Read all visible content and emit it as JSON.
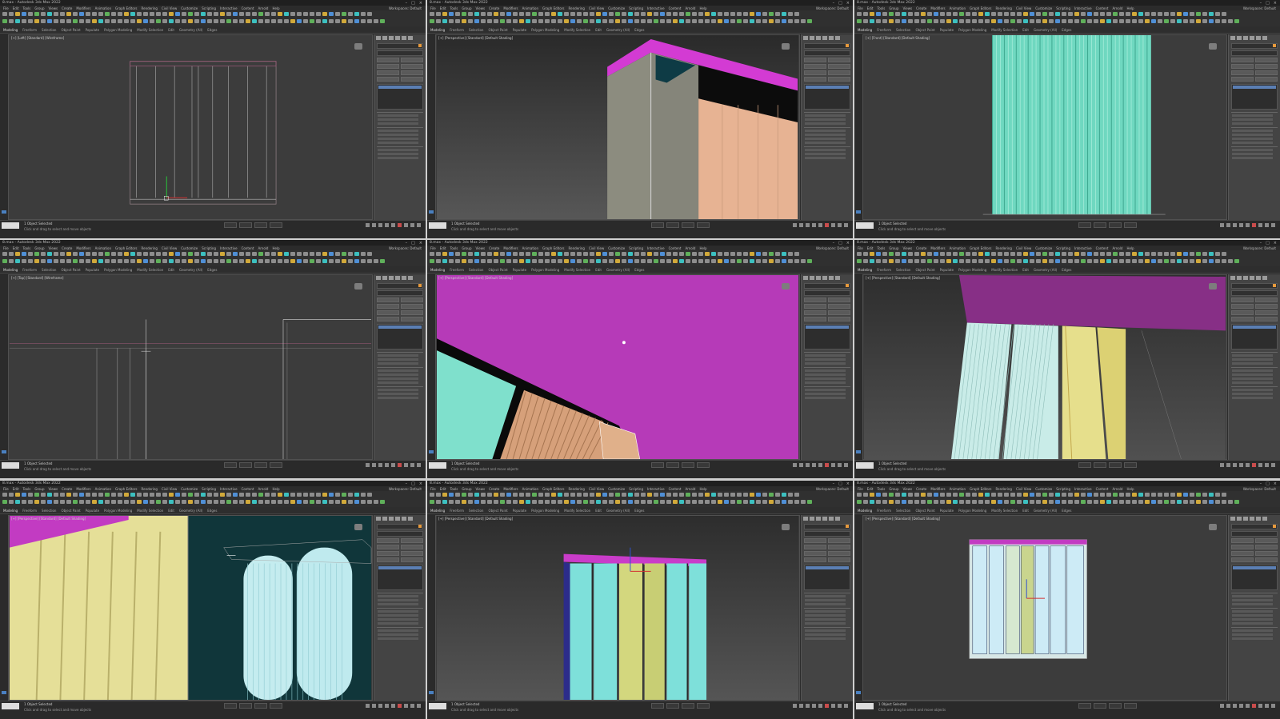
{
  "app": {
    "window_title": "8.max - Autodesk 3ds Max 2022",
    "menus": [
      "File",
      "Edit",
      "Tools",
      "Group",
      "Views",
      "Create",
      "Modifiers",
      "Animation",
      "Graph Editors",
      "Rendering",
      "Civil View",
      "Customize",
      "Scripting",
      "Interactive",
      "Content",
      "Arnold",
      "Help"
    ],
    "workspace_label": "Workspaces: Default",
    "ribbon_tabs": [
      "Modeling",
      "Freeform",
      "Selection",
      "Object Paint",
      "Populate"
    ],
    "ribbon_subtabs": [
      "Polygon Modeling",
      "Modify Selection",
      "Edit",
      "Geometry (All)",
      "Edges",
      "Loops",
      "Tris",
      "Subdivision",
      "Align",
      "Properties"
    ],
    "command_panel": {
      "object_name": "Rectangle",
      "modifier_list": "Modifier List",
      "stack_selected": "Editable Poly"
    },
    "status": {
      "script_label": "MAXScript Mi",
      "selection_text": "1 Object Selected",
      "prompt_text": "Click and drag to select and move objects",
      "grid_text": "Grid = 10,0cm",
      "add_time_tag": "Add Time Tag",
      "autokey": "Auto Key",
      "set_key": "Set Key",
      "selected": "Selected",
      "key_filters": "Key Filters..."
    },
    "icons": {
      "close": "close-icon",
      "minimize": "minimize-icon",
      "maximize": "maximize-icon"
    }
  },
  "tiles": [
    {
      "viewport_label": "[+] [Left] [Standard] [Wireframe]"
    },
    {
      "viewport_label": "[+] [Perspective] [Standard] [Default Shading]"
    },
    {
      "viewport_label": "[+] [Front] [Standard] [Default Shading]"
    },
    {
      "viewport_label": "[+] [Top] [Standard] [Wireframe]"
    },
    {
      "viewport_label": "[+] [Perspective] [Standard] [Default Shading]"
    },
    {
      "viewport_label": "[+] [Perspective] [Standard] [Default Shading]"
    },
    {
      "viewport_label": "[+] [Perspective] [Standard] [Default Shading]"
    },
    {
      "viewport_label": "[+] [Perspective] [Standard] [Default Shading]"
    },
    {
      "viewport_label": "[+] [Perspective] [Standard] [Default Shading]"
    }
  ]
}
